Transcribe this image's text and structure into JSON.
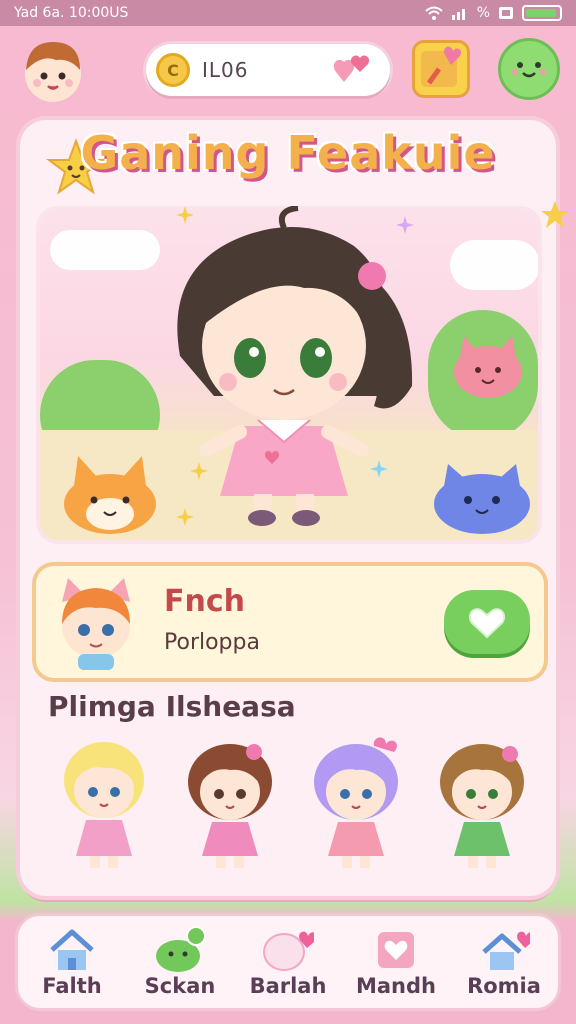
{
  "status_bar": {
    "left_text": "Yad 6a. 10:00US",
    "right_percent": "%"
  },
  "top_bar": {
    "coin_value": "IL06",
    "coin_symbol": "C"
  },
  "main": {
    "title": "Ganing Feakuie",
    "profile": {
      "name": "Fnch",
      "subtitle": "Porloppa"
    },
    "section_title": "Plimga Ilsheasa",
    "characters": [
      {
        "name": "blonde-girl",
        "hair": "#f8e27a",
        "dress": "#f3a0c8"
      },
      {
        "name": "brown-hair-girl",
        "hair": "#8a4b32",
        "dress": "#f08bbd"
      },
      {
        "name": "purple-hair-girl",
        "hair": "#b29af3",
        "dress": "#f59bb0"
      },
      {
        "name": "green-dress-girl",
        "hair": "#a7743d",
        "dress": "#6cc16a"
      }
    ]
  },
  "bottom_nav": {
    "items": [
      {
        "label": "Falth",
        "icon": "home-icon"
      },
      {
        "label": "Sckan",
        "icon": "slime-icon"
      },
      {
        "label": "Barlah",
        "icon": "speech-heart-icon"
      },
      {
        "label": "Mandh",
        "icon": "heart-card-icon"
      },
      {
        "label": "Romia",
        "icon": "heart-home-icon"
      }
    ]
  },
  "colors": {
    "accent_pink": "#f7b9cf",
    "accent_green": "#79cf5e",
    "title_orange": "#f4b04a",
    "profile_name_red": "#c24a4a"
  }
}
